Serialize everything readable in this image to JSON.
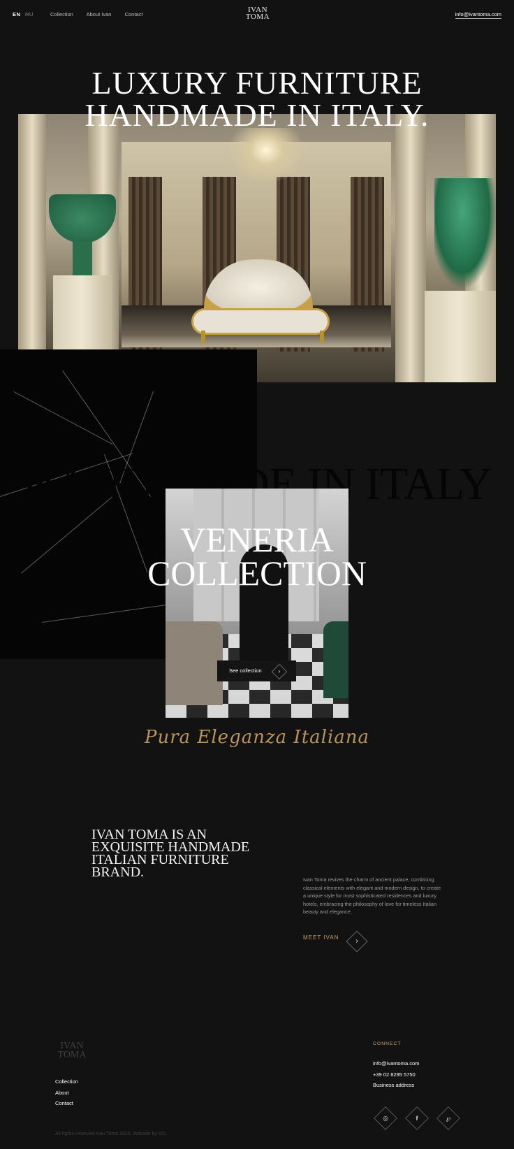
{
  "header": {
    "lang_active": "EN",
    "lang_other": "RU",
    "nav": [
      "Collection",
      "About Ivan",
      "Contact"
    ],
    "logo_line1": "IVAN",
    "logo_line2": "TOMA",
    "email": "info@ivantoma.com"
  },
  "hero": {
    "title_line1": "LUXURY FURNITURE",
    "title_line2": "HANDMADE IN ITALY."
  },
  "collection": {
    "ghost_text": "HAND MADE IN ITALY",
    "title_line1": "VENERIA",
    "title_line2": "COLLECTION",
    "button_label": "See collection",
    "button_icon": "chevron-right-icon",
    "script_text": "Pura Eleganza Italiana"
  },
  "about": {
    "heading_lines": [
      "IVAN TOMA IS AN",
      "EXQUISITE HANDMADE",
      "ITALIAN FURNITURE",
      "BRAND."
    ],
    "paragraph": "Ivan Toma revives the charm of ancient palace, combining classical elements with elegant and modern design, to create a unique style for most sophisticated residences and luxury hotels, embracing the philosophy of love for timeless Italian beauty and elegance.",
    "cta_label": "MEET IVAN",
    "accent_color": "#c9a06a"
  },
  "footer": {
    "logo_line1": "IVAN",
    "logo_line2": "TOMA",
    "links": [
      "Collection",
      "About",
      "Contact"
    ],
    "connect_heading": "CONNECT",
    "email": "info@ivantoma.com",
    "phone": "+39 02 8295 5750",
    "address_label": "Business address",
    "social_icons": [
      "instagram-icon",
      "facebook-icon",
      "pinterest-icon"
    ],
    "copyright": "All rights reserved Ivan Toma 2020. Website by GC."
  }
}
